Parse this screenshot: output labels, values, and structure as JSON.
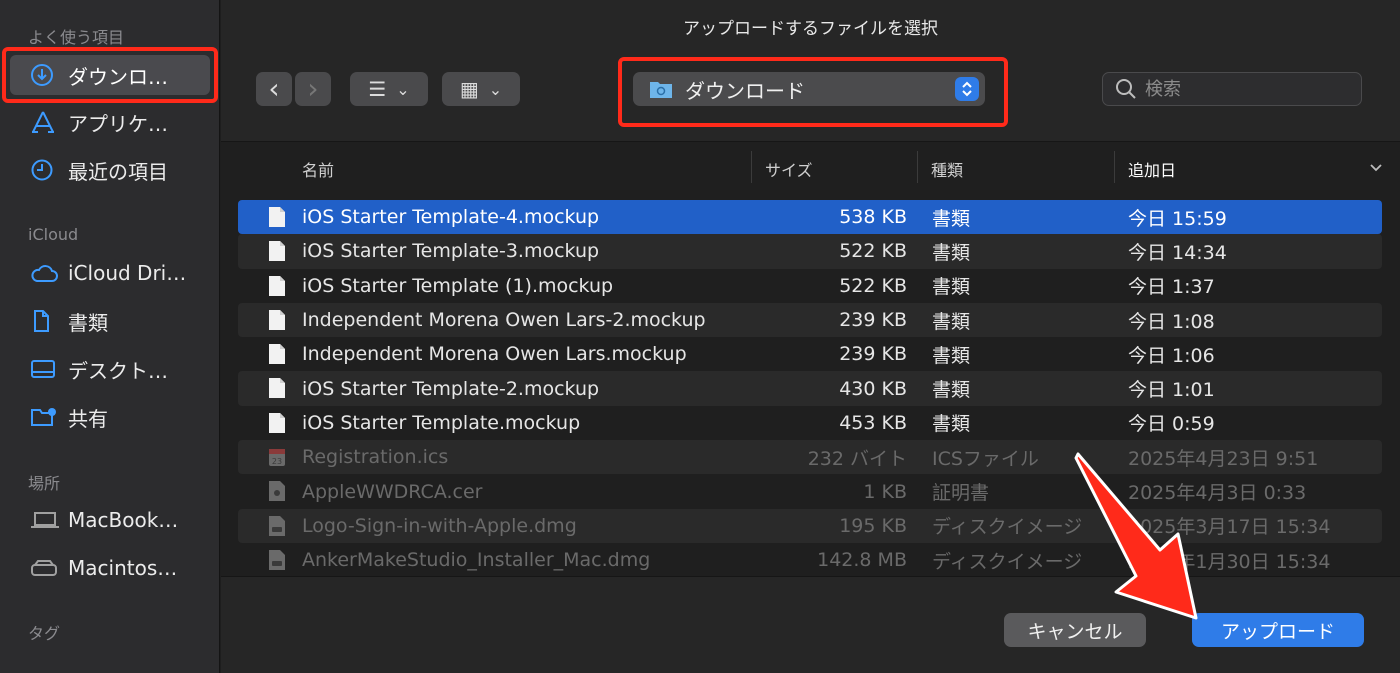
{
  "dialog": {
    "title": "アップロードするファイルを選択"
  },
  "sidebar": {
    "favorites_heading": "よく使う項目",
    "icloud_heading": "iCloud",
    "locations_heading": "場所",
    "tags_heading": "タグ",
    "favorites": [
      {
        "label": "ダウンロ…",
        "icon": "download-circle-icon"
      },
      {
        "label": "アプリケ…",
        "icon": "applications-icon"
      },
      {
        "label": "最近の項目",
        "icon": "clock-icon"
      }
    ],
    "icloud": [
      {
        "label": "iCloud Dri…",
        "icon": "cloud-icon"
      },
      {
        "label": "書類",
        "icon": "document-icon"
      },
      {
        "label": "デスクト…",
        "icon": "desktop-icon"
      },
      {
        "label": "共有",
        "icon": "shared-folder-icon"
      }
    ],
    "locations": [
      {
        "label": "MacBook…",
        "icon": "laptop-icon"
      },
      {
        "label": "Macintos…",
        "icon": "hard-drive-icon"
      }
    ]
  },
  "toolbar": {
    "back": "‹",
    "forward": "›",
    "list_view": "☰",
    "grid_view": "▦",
    "dropdown": "⌄",
    "location": "ダウンロード"
  },
  "search": {
    "placeholder": "検索"
  },
  "columns": {
    "name": "名前",
    "size": "サイズ",
    "kind": "種類",
    "date_added": "追加日"
  },
  "files": [
    {
      "name": "iOS Starter Template-4.mockup",
      "size": "538 KB",
      "kind": "書類",
      "date": "今日 15:59",
      "selected": true,
      "disabled": false,
      "icon": "doc"
    },
    {
      "name": "iOS Starter Template-3.mockup",
      "size": "522 KB",
      "kind": "書類",
      "date": "今日 14:34",
      "selected": false,
      "disabled": false,
      "icon": "doc"
    },
    {
      "name": "iOS Starter Template (1).mockup",
      "size": "522 KB",
      "kind": "書類",
      "date": "今日 1:37",
      "selected": false,
      "disabled": false,
      "icon": "doc"
    },
    {
      "name": "Independent Morena Owen Lars-2.mockup",
      "size": "239 KB",
      "kind": "書類",
      "date": "今日 1:08",
      "selected": false,
      "disabled": false,
      "icon": "doc"
    },
    {
      "name": "Independent Morena Owen Lars.mockup",
      "size": "239 KB",
      "kind": "書類",
      "date": "今日 1:06",
      "selected": false,
      "disabled": false,
      "icon": "doc"
    },
    {
      "name": "iOS Starter Template-2.mockup",
      "size": "430 KB",
      "kind": "書類",
      "date": "今日 1:01",
      "selected": false,
      "disabled": false,
      "icon": "doc"
    },
    {
      "name": "iOS Starter Template.mockup",
      "size": "453 KB",
      "kind": "書類",
      "date": "今日 0:59",
      "selected": false,
      "disabled": false,
      "icon": "doc"
    },
    {
      "name": "Registration.ics",
      "size": "232 バイト",
      "kind": "ICSファイル",
      "date": "2025年4月23日 9:51",
      "selected": false,
      "disabled": true,
      "icon": "calendar"
    },
    {
      "name": "AppleWWDRCA.cer",
      "size": "1 KB",
      "kind": "証明書",
      "date": "2025年4月3日 0:33",
      "selected": false,
      "disabled": true,
      "icon": "cert"
    },
    {
      "name": "Logo-Sign-in-with-Apple.dmg",
      "size": "195 KB",
      "kind": "ディスクイメージ",
      "date": "2025年3月17日 15:34",
      "selected": false,
      "disabled": true,
      "icon": "dmg"
    },
    {
      "name": "AnkerMakeStudio_Installer_Mac.dmg",
      "size": "142.8 MB",
      "kind": "ディスクイメージ",
      "date": "2025年1月30日 15:34",
      "selected": false,
      "disabled": true,
      "icon": "dmg"
    }
  ],
  "footer": {
    "cancel": "キャンセル",
    "upload": "アップロード"
  },
  "colors": {
    "accent": "#2f7ce8",
    "selection": "#2160c8",
    "highlight": "#ff2a1a"
  }
}
